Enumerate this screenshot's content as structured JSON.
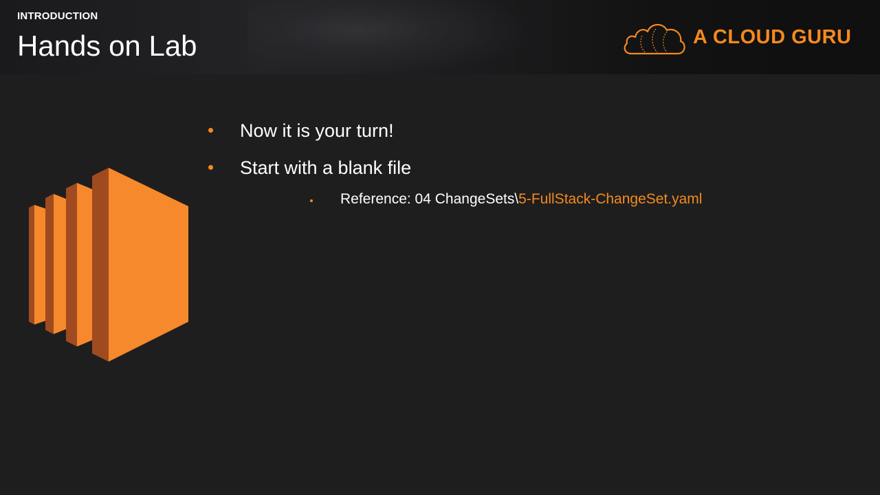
{
  "header": {
    "section_label": "INTRODUCTION",
    "title": "Hands on Lab",
    "logo_text": "A CLOUD GURU"
  },
  "icons": {
    "logo": "cloud-logo-icon",
    "main": "ec2-instances-icon"
  },
  "bullets": [
    {
      "text": "Now it is your turn!"
    },
    {
      "text": "Start with a blank file"
    }
  ],
  "sub_bullet": {
    "prefix": "Reference: 04 ChangeSets\\",
    "link": "5-FullStack-ChangeSet.yaml"
  },
  "colors": {
    "accent": "#f6891f",
    "background": "#1e1e1e",
    "text": "#ffffff"
  }
}
